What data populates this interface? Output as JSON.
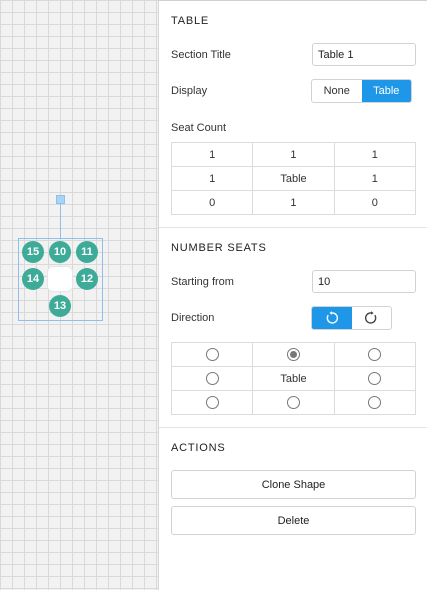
{
  "canvas": {
    "seats": [
      "15",
      "10",
      "11",
      "14",
      "12",
      "13"
    ]
  },
  "table_section": {
    "heading": "TABLE",
    "section_title_label": "Section Title",
    "section_title_value": "Table 1",
    "display_label": "Display",
    "display_options": [
      "None",
      "Table"
    ],
    "display_selected": "Table",
    "seat_count_label": "Seat Count",
    "seat_count_grid": [
      [
        "1",
        "1",
        "1"
      ],
      [
        "1",
        "Table",
        "1"
      ],
      [
        "0",
        "1",
        "0"
      ]
    ]
  },
  "number_seats": {
    "heading": "NUMBER SEATS",
    "starting_from_label": "Starting from",
    "starting_from_value": "10",
    "direction_label": "Direction",
    "direction_options": [
      "counterclockwise-icon",
      "clockwise-icon"
    ],
    "direction_selected": "counterclockwise",
    "start_grid_center": "Table",
    "start_selected": "top-center"
  },
  "actions": {
    "heading": "ACTIONS",
    "clone_label": "Clone Shape",
    "delete_label": "Delete"
  },
  "colors": {
    "accent": "#1f97e8",
    "seat": "#3dab98"
  }
}
